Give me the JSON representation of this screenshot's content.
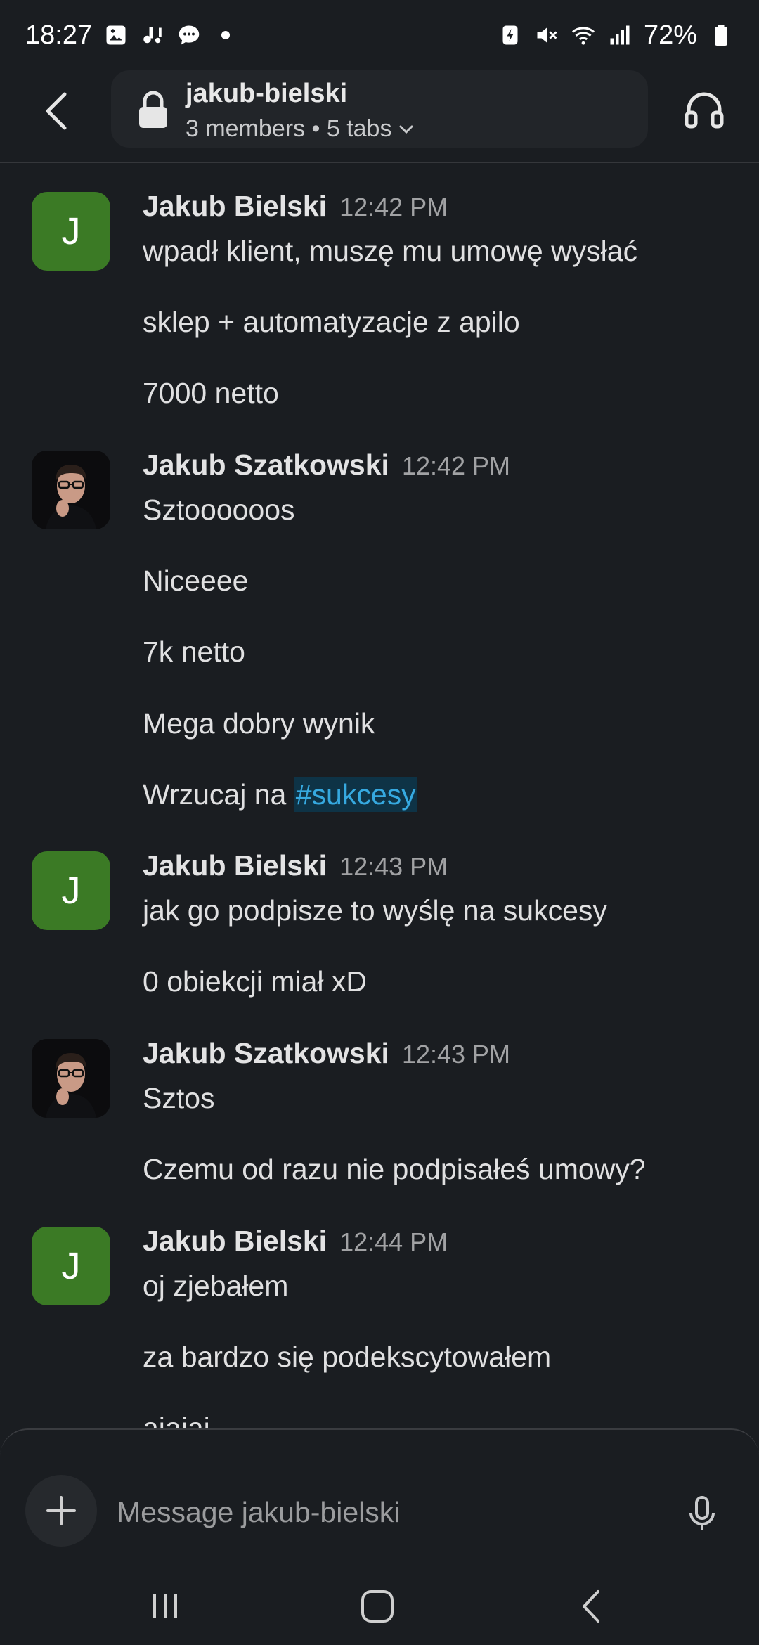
{
  "status_bar": {
    "time": "18:27",
    "battery": "72%",
    "left_icons": [
      "gallery-icon",
      "voicemail-icon",
      "chat-bubble-icon",
      "dot-icon"
    ],
    "right_icons": [
      "battery-saver-icon",
      "mute-icon",
      "wifi-icon",
      "signal-icon",
      "battery-icon"
    ]
  },
  "header": {
    "channel_name": "jakub-bielski",
    "meta": "3 members • 5 tabs",
    "icons": [
      "back-icon",
      "lock-icon",
      "chevron-down-icon",
      "headphones-icon"
    ]
  },
  "messages": [
    {
      "author": "Jakub Bielski",
      "time": "12:42 PM",
      "avatar_letter": "J",
      "lines": [
        "wpadł klient, muszę mu umowę wysłać",
        "sklep + automatyzacje z apilo",
        "7000 netto"
      ]
    },
    {
      "author": "Jakub Szatkowski",
      "time": "12:42 PM",
      "avatar_letter": "",
      "lines": [
        "Sztoooooos",
        "Niceeee",
        "7k netto",
        "Mega dobry wynik"
      ],
      "last_line_prefix": "Wrzucaj na ",
      "last_line_mention": "#sukcesy"
    },
    {
      "author": "Jakub Bielski",
      "time": "12:43 PM",
      "avatar_letter": "J",
      "lines": [
        "jak go podpisze to wyślę na sukcesy",
        "0 obiekcji miał xD"
      ]
    },
    {
      "author": "Jakub Szatkowski",
      "time": "12:43 PM",
      "avatar_letter": "",
      "lines": [
        "Sztos",
        "Czemu od razu nie podpisałeś umowy?"
      ]
    },
    {
      "author": "Jakub Bielski",
      "time": "12:44 PM",
      "avatar_letter": "J",
      "lines": [
        "oj zjebałem",
        "za bardzo się podekscytowałem",
        "ajajaj"
      ]
    }
  ],
  "composer": {
    "placeholder": "Message jakub-bielski",
    "icons": [
      "plus-icon",
      "microphone-icon"
    ]
  },
  "nav_bar": {
    "icons": [
      "recent-apps-icon",
      "home-icon",
      "back-nav-icon"
    ]
  },
  "colors": {
    "background": "#1a1d21",
    "avatar_green": "#3b7a25",
    "mention_text": "#36a9e0",
    "mention_bg": "#0e3346"
  }
}
